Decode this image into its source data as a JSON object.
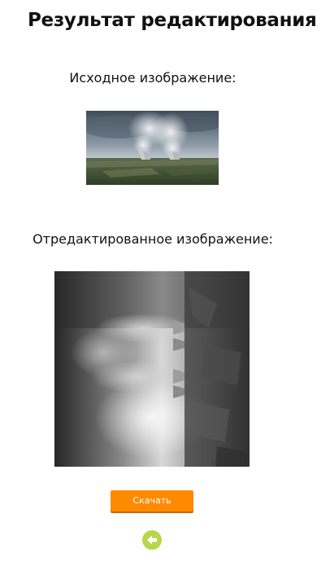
{
  "header": {
    "title": "Результат редактирования"
  },
  "original_section": {
    "label": "Исходное изображение:",
    "image_alt": "power-plant-cooling-towers-photo"
  },
  "edited_section": {
    "label": "Отредактированное изображение:",
    "image_alt": "power-plant-grayscale-rotated-photo"
  },
  "actions": {
    "download_label": "Скачать",
    "download_color": "#ff8a00",
    "back_icon": "back-arrow-icon",
    "back_color": "#b7d64a"
  }
}
